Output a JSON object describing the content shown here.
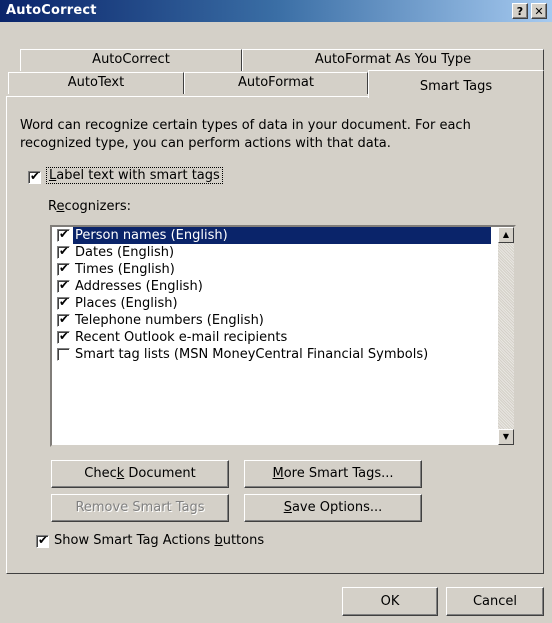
{
  "window": {
    "title": "AutoCorrect",
    "help_glyph": "?",
    "close_glyph": "✕"
  },
  "tabs": {
    "row1": [
      "AutoCorrect",
      "AutoFormat As You Type"
    ],
    "row2": [
      "AutoText",
      "AutoFormat",
      "Smart Tags"
    ],
    "active": "Smart Tags"
  },
  "smart_tags": {
    "description_line1": "Word can recognize certain types of data in your document. For each",
    "description_line2": "recognized type, you can perform actions with that data.",
    "label_checkbox": {
      "text_pre": "",
      "accel": "L",
      "text_post": "abel text with smart tags",
      "checked": true
    },
    "recognizers_label": {
      "text_pre": "R",
      "accel": "e",
      "text_post": "cognizers:"
    },
    "recognizers": [
      {
        "label": "Person names (English)",
        "checked": true,
        "selected": true
      },
      {
        "label": "Dates (English)",
        "checked": true,
        "selected": false
      },
      {
        "label": "Times (English)",
        "checked": true,
        "selected": false
      },
      {
        "label": "Addresses (English)",
        "checked": true,
        "selected": false
      },
      {
        "label": "Places (English)",
        "checked": true,
        "selected": false
      },
      {
        "label": "Telephone numbers (English)",
        "checked": true,
        "selected": false
      },
      {
        "label": "Recent Outlook e-mail recipients",
        "checked": true,
        "selected": false
      },
      {
        "label": "Smart tag lists (MSN MoneyCentral Financial Symbols)",
        "checked": false,
        "selected": false
      }
    ],
    "buttons": {
      "check_document": {
        "pre": "Chec",
        "accel": "k",
        "post": " Document"
      },
      "more_smart_tags": {
        "pre": "",
        "accel": "M",
        "post": "ore Smart Tags..."
      },
      "remove_smart_tags": {
        "pre": "Remove Smart Tags",
        "accel": "",
        "post": "",
        "disabled": true
      },
      "save_options": {
        "pre": "",
        "accel": "S",
        "post": "ave Options..."
      }
    },
    "show_actions": {
      "pre": "Show Smart Tag Actions ",
      "accel": "b",
      "post": "uttons",
      "checked": true
    }
  },
  "footer": {
    "ok": "OK",
    "cancel": "Cancel"
  }
}
